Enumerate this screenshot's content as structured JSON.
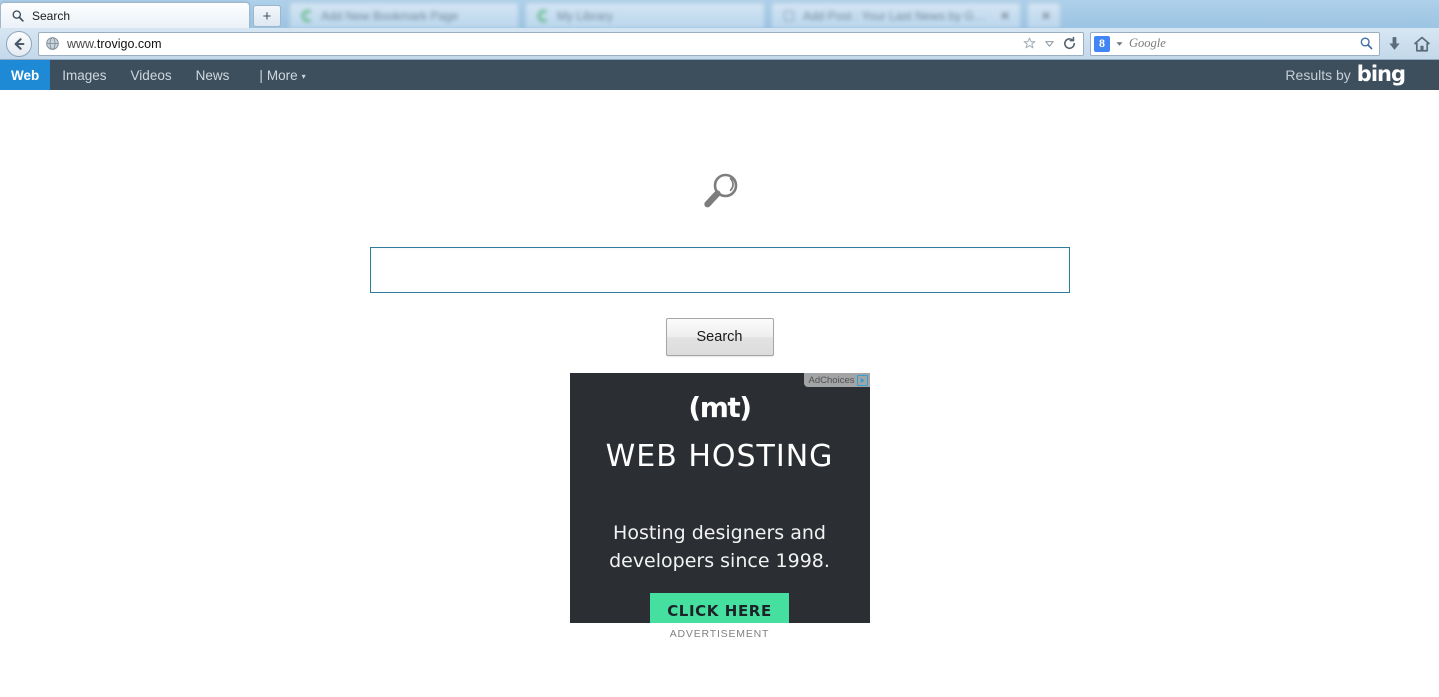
{
  "browser": {
    "tabs": [
      {
        "title": "Search",
        "favicon": "magnifier-icon",
        "active": true,
        "blurred": false
      },
      {
        "title": "Add New Bookmark  Page",
        "favicon": "green-c-icon",
        "active": false,
        "blurred": true
      },
      {
        "title": "My Library",
        "favicon": "green-c-icon",
        "active": false,
        "blurred": true
      },
      {
        "title": "Add Post : Your Last News by Guides  ...",
        "favicon": "page-icon",
        "active": false,
        "blurred": true
      }
    ],
    "new_tab_label": "+",
    "back_button": "back-arrow",
    "url": {
      "prefix": "www.",
      "domain": "trovigo.com",
      "full": "www.trovigo.com",
      "favicon": "globe-icon"
    },
    "url_icons": [
      "bookmark-star-icon",
      "dropdown-caret-icon",
      "reload-icon"
    ],
    "search_box": {
      "engine": "Google",
      "engine_icon_letter": "8",
      "placeholder": "Google",
      "value": ""
    },
    "toolbar_icons": [
      "download-icon",
      "home-icon"
    ]
  },
  "sitenav": {
    "items": [
      {
        "label": "Web",
        "active": true
      },
      {
        "label": "Images",
        "active": false
      },
      {
        "label": "Videos",
        "active": false
      },
      {
        "label": "News",
        "active": false
      }
    ],
    "more": {
      "separator": "|",
      "label": "More",
      "caret": "▾"
    },
    "results_by": {
      "text": "Results by",
      "brand": "bing"
    },
    "colors": {
      "background": "#3d4f5d",
      "active": "#1e8ad6"
    }
  },
  "main": {
    "logo_icon": "magnifier-logo-icon",
    "search_input": {
      "value": "",
      "placeholder": ""
    },
    "search_button": "Search",
    "input_border_color": "#2e7d9a"
  },
  "advertisement": {
    "adchoices_label": "AdChoices",
    "adchoices_icon": "adchoices-triangle-icon",
    "brand": "(mt)",
    "headline": "WEB HOSTING",
    "subhead_line1": "Hosting designers and",
    "subhead_line2": "developers since 1998.",
    "cta": "CLICK HERE",
    "label": "ADVERTISEMENT",
    "colors": {
      "background": "#2b2e33",
      "cta": "#45dfa0",
      "cta_text": "#1d2226"
    }
  }
}
